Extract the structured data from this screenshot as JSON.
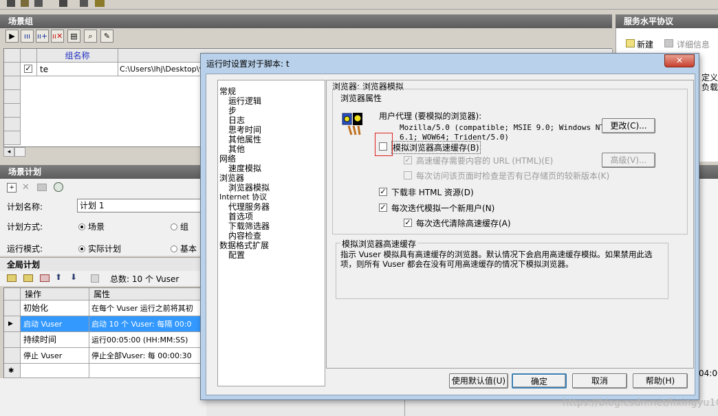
{
  "scenario_groups": {
    "title": "场景组",
    "col_group_name": "组名称",
    "row1_name": "te",
    "row1_path": "C:\\Users\\lhj\\Desktop\\性"
  },
  "sla": {
    "title": "服务水平协议",
    "new_label": "新建",
    "details_label": "详细信息",
    "side_text1": "定义",
    "side_text2": "负载"
  },
  "scenario_plan": {
    "title": "场景计划",
    "plan_name_label": "计划名称:",
    "plan_name_value": "计划 1",
    "plan_mode_label": "计划方式:",
    "plan_mode_opt1": "场景",
    "plan_mode_opt2": "组",
    "run_mode_label": "运行模式:",
    "run_mode_opt1": "实际计划",
    "run_mode_opt2": "基本"
  },
  "global_plan": {
    "title": "全局计划",
    "total": "总数: 10 个 Vuser",
    "col_action": "操作",
    "col_props": "属性",
    "rows": [
      {
        "action": "初始化",
        "props": "在每个 Vuser 运行之前将其初"
      },
      {
        "action": "启动 Vuser",
        "props": "启动 10 个 Vuser: 每隔 00:0"
      },
      {
        "action": "持续时间",
        "props": "运行00:05:00 (HH:MM:SS)"
      },
      {
        "action": "停止 Vuser",
        "props": "停止全部Vuser: 每 00:00:30"
      }
    ],
    "star": "✱"
  },
  "side_time": "04:00",
  "dialog": {
    "title": "运行时设置对于脚本: t",
    "close": "✕",
    "tree": {
      "n1": "常规",
      "n1_1": "运行逻辑",
      "n1_2": "步",
      "n1_3": "日志",
      "n1_4": "思考时间",
      "n1_5": "其他属性",
      "n1_6": "其他",
      "n2": "网络",
      "n2_1": "速度模拟",
      "n3": "浏览器",
      "n3_1": "浏览器模拟",
      "n4": "Internet 协议",
      "n4_1": "代理服务器",
      "n4_2": "首选项",
      "n4_3": "下载筛选器",
      "n4_4": "内容检查",
      "n5": "数据格式扩展",
      "n5_1": "配置"
    },
    "section_title": "浏览器: 浏览器模拟",
    "props_label": "浏览器属性",
    "ua_label": "用户代理 (要模拟的浏览器):",
    "ua_line1": "Mozilla/5.0 (compatible; MSIE 9.0; Windows NT",
    "ua_line2": "6.1; WOW64; Trident/5.0)",
    "change_btn": "更改(C)...",
    "sim_cache": "模拟浏览器高速缓存(B)",
    "cache_url": "高速缓存需要内容的 URL (HTML)(E)",
    "advanced_btn": "高级(V)...",
    "check_newer": "每次访问该页面时检查是否有已存储页的较新版本(K)",
    "download_non_html": "下载非 HTML 资源(D)",
    "new_user": "每次迭代模拟一个新用户(N)",
    "clear_cache": "每次迭代清除高速缓存(A)",
    "desc_title": "模拟浏览器高速缓存",
    "desc_text": "指示 Vuser 模拟具有高速缓存的浏览器。默认情况下会启用高速缓存模拟。如果禁用此选项，则所有 Vuser 都会在没有可用高速缓存的情况下模拟浏览器。",
    "btn_default": "使用默认值(U)",
    "btn_ok": "确定",
    "btn_cancel": "取消",
    "btn_help": "帮助(H)"
  },
  "watermark": "https://blog.csdn.net/lixingyu10",
  "colors": {
    "title_gray": "#5c5c5c",
    "dialog_frame": "#b9d1ea",
    "highlight": "#3399ff",
    "red_box": "#e02020"
  }
}
